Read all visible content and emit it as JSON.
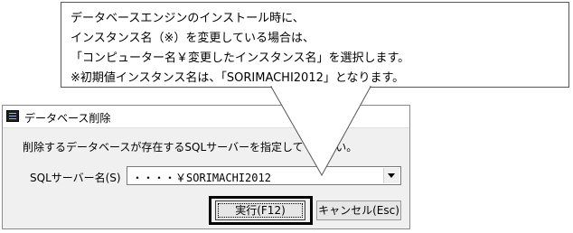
{
  "callout": {
    "lines": [
      "データベースエンジンのインストール時に、",
      "インスタンス名（※）を変更している場合は、",
      "「コンピューター名￥変更したインスタンス名」を選択します。",
      "※初期値インスタンス名は、「SORIMACHI2012」となります。"
    ]
  },
  "dialog": {
    "title": "データベース削除",
    "prompt": "削除するデータベースが存在するSQLサーバーを指定してください。",
    "server_label": "SQLサーバー名(S)",
    "server_value": "・・・・￥SORIMACHI2012",
    "execute_label": "実行(F12)",
    "cancel_label": "キャンセル(Esc)"
  }
}
